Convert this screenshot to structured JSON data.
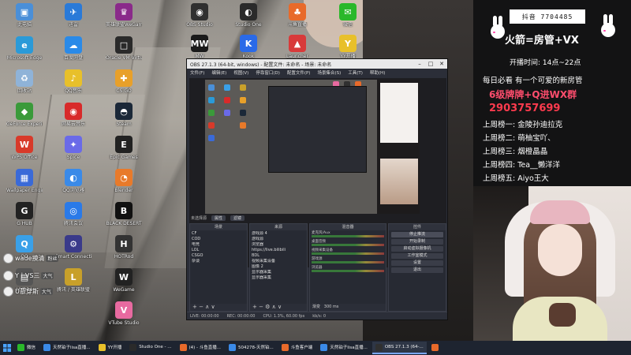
{
  "desktop": {
    "icons": [
      {
        "label": "此电脑",
        "color": "#4a8fd8",
        "glyph": "▣",
        "name": "this-pc-icon"
      },
      {
        "label": "Microsoft Edge",
        "color": "#2a9ad8",
        "glyph": "e",
        "name": "edge-icon"
      },
      {
        "label": "回收站",
        "color": "#8fb3d8",
        "glyph": "♻",
        "name": "recycle-bin-icon"
      },
      {
        "label": "GeForce Experience",
        "color": "#3a9a3a",
        "glyph": "◆",
        "name": "geforce-icon"
      },
      {
        "label": "WPS Office",
        "color": "#d83a2a",
        "glyph": "W",
        "name": "wps-icon"
      },
      {
        "label": "Wallpaper Engine",
        "color": "#3a6ad8",
        "glyph": "▦",
        "name": "wallpaper-engine-icon"
      },
      {
        "label": "G HUB",
        "color": "#222222",
        "glyph": "G",
        "name": "ghub-icon"
      },
      {
        "label": "QQ",
        "color": "#3aa0e8",
        "glyph": "Q",
        "name": "qq-icon"
      },
      {
        "label": "HYDRA",
        "color": "#555555",
        "glyph": "▤",
        "name": "hydra-icon"
      },
      {
        "label": "迅雷",
        "color": "#2a7ad8",
        "glyph": "✈",
        "name": "xunlei-icon"
      },
      {
        "label": "百度网盘",
        "color": "#2a8ae8",
        "glyph": "☁",
        "name": "baidu-pan-icon"
      },
      {
        "label": "QQ音乐",
        "color": "#e8c02a",
        "glyph": "♪",
        "name": "qq-music-icon"
      },
      {
        "label": "网易云音乐",
        "color": "#d82a2a",
        "glyph": "◉",
        "name": "netease-music-icon"
      },
      {
        "label": "Spice",
        "color": "#6a6ae8",
        "glyph": "✦",
        "name": "spice-icon"
      },
      {
        "label": "QQ浏览器",
        "color": "#3a8ae8",
        "glyph": "◐",
        "name": "qq-browser-icon"
      },
      {
        "label": "腾讯会议",
        "color": "#2a7ae8",
        "glyph": "◎",
        "name": "tencent-meeting-icon"
      },
      {
        "label": "Smart Connection",
        "color": "#3a3a8a",
        "glyph": "⚙",
        "name": "smart-connection-icon"
      },
      {
        "label": "腾讯 / 英雄联盟",
        "color": "#c8a02a",
        "glyph": "L",
        "name": "lol-icon"
      },
      {
        "label": "英雄联盟WeGame版",
        "color": "#8a2a8a",
        "glyph": "♛",
        "name": "lol-wegame-icon"
      },
      {
        "label": "Oracle VM VirtualBox",
        "color": "#2a2a2a",
        "glyph": "□",
        "name": "virtualbox-icon"
      },
      {
        "label": "CS:GO",
        "color": "#e8a02a",
        "glyph": "✚",
        "name": "csgo-icon"
      },
      {
        "label": "Steam",
        "color": "#1b2838",
        "glyph": "◓",
        "name": "steam-icon"
      },
      {
        "label": "Epic Games",
        "color": "#222222",
        "glyph": "E",
        "name": "epic-icon"
      },
      {
        "label": "Blender",
        "color": "#e87a2a",
        "glyph": "◔",
        "name": "blender-icon"
      },
      {
        "label": "BLACK DESERT",
        "color": "#111111",
        "glyph": "B",
        "name": "black-desert-icon"
      },
      {
        "label": "HOTRod",
        "color": "#333333",
        "glyph": "H",
        "name": "hotrod-icon"
      },
      {
        "label": "WeGame",
        "color": "#222222",
        "glyph": "W",
        "name": "wegame-icon"
      },
      {
        "label": "VTube Studio",
        "color": "#e86aa0",
        "glyph": "V",
        "name": "vtube-studio-icon"
      },
      {
        "label": "OBS Studio",
        "color": "#303030",
        "glyph": "◉",
        "name": "obs-icon"
      },
      {
        "label": "Studio One",
        "color": "#2a2a2a",
        "glyph": "◐",
        "name": "studio-one-icon"
      },
      {
        "label": "斗鱼直播",
        "color": "#e86a2a",
        "glyph": "♣",
        "name": "douyu-icon"
      },
      {
        "label": "微信",
        "color": "#2ab82a",
        "glyph": "✉",
        "name": "wechat-icon"
      },
      {
        "label": "MW",
        "color": "#1a1a1a",
        "glyph": "MW",
        "name": "mw-icon"
      },
      {
        "label": "Kook",
        "color": "#2a6ae8",
        "glyph": "K",
        "name": "kook-icon"
      },
      {
        "label": "Launcher",
        "color": "#d83a3a",
        "glyph": "▲",
        "name": "launcher-icon"
      },
      {
        "label": "YY开播",
        "color": "#e8c02a",
        "glyph": "Y",
        "name": "yy-icon"
      }
    ]
  },
  "obs": {
    "title": "OBS 27.1.3 (64-bit, windows) - 配置文件: 未命名 - 场景: 未命名",
    "menu": [
      "文件(F)",
      "编辑(E)",
      "视图(V)",
      "停靠窗口(D)",
      "配置文件(P)",
      "场景集合(S)",
      "工具(T)",
      "帮助(H)"
    ],
    "scene_bar_label": "未选择源",
    "scene_bar_buttons": [
      "属性",
      "滤镜"
    ],
    "docks": {
      "scenes": {
        "title": "场景",
        "items": [
          "CF",
          "COD",
          "电竞",
          "LOL",
          "CSGO",
          "杂谈"
        ]
      },
      "sources": {
        "title": "来源",
        "items": [
          "游戏源 4",
          "游戏源",
          "浏览器",
          "https://live.bilibili",
          "BDL",
          "视频采集设备",
          "图像 2",
          "显示器采集",
          "显示器采集"
        ]
      },
      "mixer": {
        "title": "混音器",
        "items": [
          "麦克风/Aux",
          "桌面音频",
          "视频采集设备",
          "游戏源",
          "浏览器"
        ]
      },
      "transitions": {
        "title": "转场",
        "items": [
          "渐变",
          "300 ms"
        ]
      },
      "controls": {
        "title": "控件",
        "items": [
          "停止推流",
          "开始录制",
          "启动虚拟摄像机",
          "工作室模式",
          "设置",
          "退出"
        ]
      }
    },
    "status": [
      "LIVE: 00:00:00",
      "REC: 00:00:00",
      "CPU: 1.3%, 60.00 fps",
      "kb/s: 0"
    ]
  },
  "stream_card": {
    "qq_label": "抖音 7704485",
    "title": "火箭=房管+VX",
    "time": "开播时间: 14点~22点",
    "rule": "每日必看 有一个可爱的新房管",
    "promo": "6级牌牌+Q进WX群",
    "qq_number": "2903757699",
    "ranks": [
      "上周榜一: 金陵孙迪拉克",
      "上周榜二: 萌柚宝吖、",
      "上周榜三: 烟橙晶晶",
      "上周榜四: Tea__懒洋洋",
      "上周榜五: Aiyo王大"
    ]
  },
  "danmaku": [
    {
      "text": "wade摸清",
      "badge": "粉丝"
    },
    {
      "text": "Y丨VS三",
      "badge": "大气"
    },
    {
      "text": "U慕穿斯",
      "badge": "大气"
    }
  ],
  "taskbar": {
    "items": [
      {
        "label": "微信",
        "color": "#2ab82a",
        "name": "taskbar-wechat"
      },
      {
        "label": "天然铂子lisa直播...",
        "color": "#3a8ae8",
        "name": "taskbar-browser-1"
      },
      {
        "label": "YY开播",
        "color": "#e8c02a",
        "name": "taskbar-yy"
      },
      {
        "label": "Studio One - ...",
        "color": "#2a2a2a",
        "name": "taskbar-studio-one"
      },
      {
        "label": "(4) - 斗鱼直播...",
        "color": "#e86a2a",
        "name": "taskbar-douyu"
      },
      {
        "label": "504278-天然铂...",
        "color": "#3a8ae8",
        "name": "taskbar-browser-2"
      },
      {
        "label": "斗鱼客户端",
        "color": "#e86a2a",
        "name": "taskbar-douyu-client"
      },
      {
        "label": "天然铂子lisa直播...",
        "color": "#3a8ae8",
        "name": "taskbar-browser-3"
      },
      {
        "label": "OBS 27.1.3 (64-...",
        "color": "#303030",
        "name": "taskbar-obs"
      },
      {
        "label": "",
        "color": "#e86a2a",
        "name": "taskbar-extra"
      }
    ]
  }
}
